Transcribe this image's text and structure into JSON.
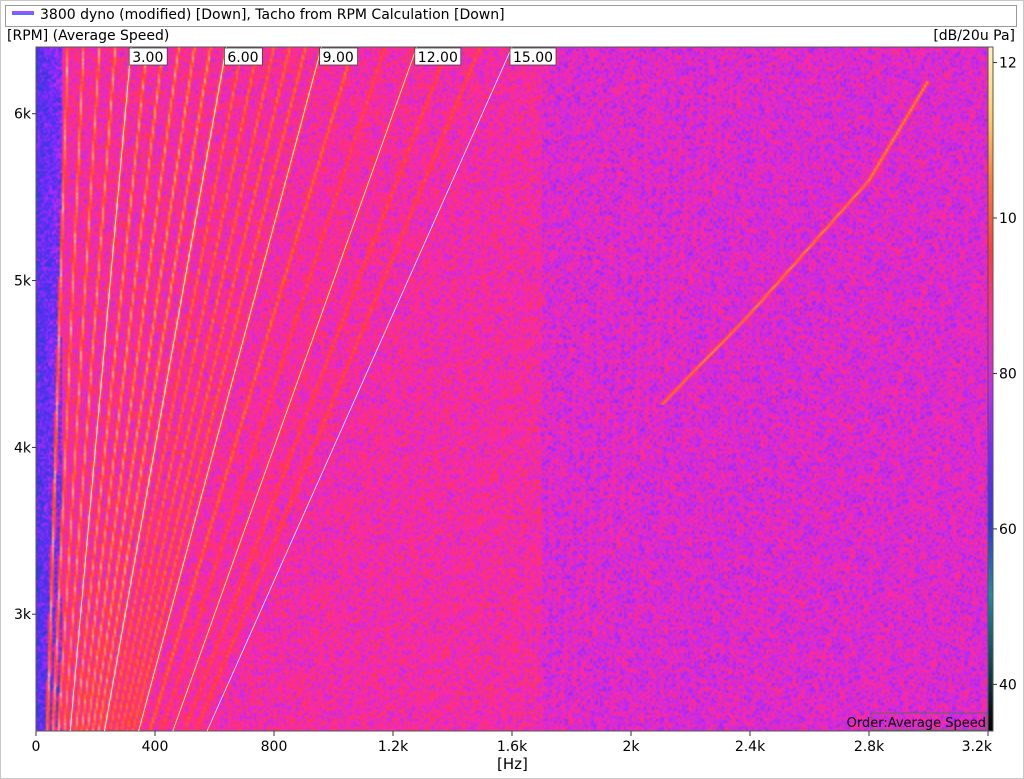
{
  "legend": {
    "text": "3800 dyno (modified) [Down], Tacho from RPM Calculation [Down]"
  },
  "units": {
    "y": "[RPM] (Average Speed)",
    "z": "[dB/20u Pa]",
    "x": "[Hz]"
  },
  "chart_data": {
    "type": "heatmap",
    "title": "",
    "xlabel": "[Hz]",
    "ylabel": "[RPM] (Average Speed)",
    "zlabel": "[dB/20u Pa]",
    "xlim": [
      0,
      3200
    ],
    "ylim": [
      2300,
      6400
    ],
    "zlim": [
      34,
      122
    ],
    "x_ticks": [
      {
        "value": 0,
        "label": "0"
      },
      {
        "value": 400,
        "label": "400"
      },
      {
        "value": 800,
        "label": "800"
      },
      {
        "value": 1200,
        "label": "1.2k"
      },
      {
        "value": 1600,
        "label": "1.6k"
      },
      {
        "value": 2000,
        "label": "2k"
      },
      {
        "value": 2400,
        "label": "2.4k"
      },
      {
        "value": 2800,
        "label": "2.8k"
      },
      {
        "value": 3200,
        "label": "3.2k"
      }
    ],
    "y_ticks": [
      {
        "value": 3000,
        "label": "3k"
      },
      {
        "value": 4000,
        "label": "4k"
      },
      {
        "value": 5000,
        "label": "5k"
      },
      {
        "value": 6000,
        "label": "6k"
      }
    ],
    "z_ticks": [
      {
        "value": 40,
        "label": "40"
      },
      {
        "value": 60,
        "label": "60"
      },
      {
        "value": 80,
        "label": "80"
      },
      {
        "value": 100,
        "label": "10"
      },
      {
        "value": 120,
        "label": "12"
      }
    ],
    "colorscale": [
      "#000000",
      "#0a4a55",
      "#1a8f9a",
      "#2e3bd6",
      "#6a2cff",
      "#c22cf0",
      "#ff2aa0",
      "#ff3c3c",
      "#ff7a30",
      "#ffd060",
      "#fff4b0"
    ],
    "background_level": 86,
    "order_lines": [
      {
        "order": 3,
        "label": "3.00",
        "shown_label": true
      },
      {
        "order": 6,
        "label": "6.00",
        "shown_label": true
      },
      {
        "order": 9,
        "label": "9.00",
        "shown_label": true
      },
      {
        "order": 12,
        "label": "12.00",
        "shown_label": true
      },
      {
        "order": 15,
        "label": "15.00",
        "shown_label": true
      }
    ],
    "highlighted_orders": [
      1,
      1.5,
      2,
      2.5,
      3,
      3.5,
      4,
      4.5,
      5,
      5.5,
      6,
      6.5,
      7,
      7.5,
      8,
      8.5,
      9,
      10,
      11,
      12,
      13,
      14
    ],
    "resonance_band": {
      "points": [
        [
          2100,
          4250
        ],
        [
          2400,
          4800
        ],
        [
          2800,
          5600
        ],
        [
          3000,
          6200
        ]
      ],
      "level": 106
    },
    "annotation": "Order:Average Speed"
  }
}
